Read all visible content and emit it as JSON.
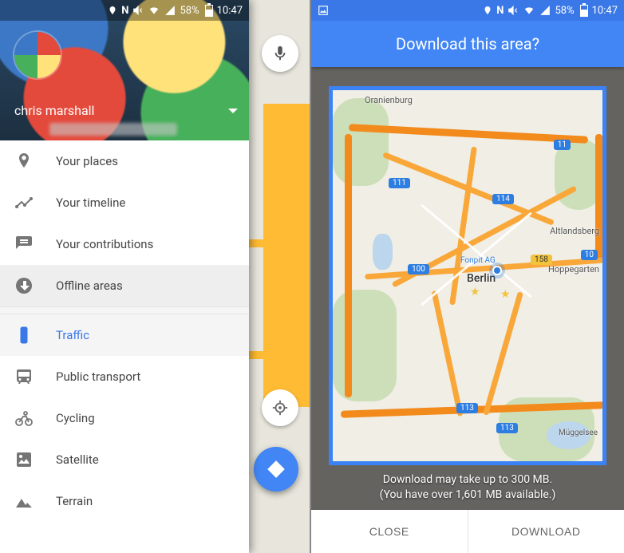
{
  "status": {
    "battery_pct": "58%",
    "time": "10:47"
  },
  "left": {
    "user_name": "chris marshall",
    "menu": {
      "your_places": "Your places",
      "your_timeline": "Your timeline",
      "your_contributions": "Your contributions",
      "offline_areas": "Offline areas",
      "traffic": "Traffic",
      "public_transport": "Public transport",
      "cycling": "Cycling",
      "satellite": "Satellite",
      "terrain": "Terrain"
    }
  },
  "right": {
    "title": "Download this area?",
    "info_line1": "Download may take up to 300 MB.",
    "info_line2": "(You have over 1,601 MB available.)",
    "close_label": "CLOSE",
    "download_label": "DOWNLOAD",
    "map": {
      "city_main": "Berlin",
      "poi": "Fonpit AG",
      "labels": {
        "oranienburg": "Oranienburg",
        "altlandsberg": "Altlandsberg",
        "hoppegarten": "Hoppegarten",
        "mugge": "Müggelsee"
      },
      "shields": {
        "a11": "11",
        "a111": "111",
        "a114": "114",
        "a100": "100",
        "a158": "158",
        "a10e": "10",
        "a113": "113",
        "a113b": "113"
      }
    }
  }
}
